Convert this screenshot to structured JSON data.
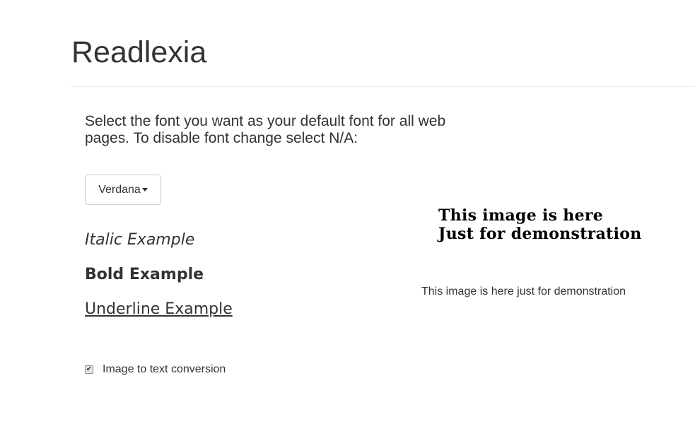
{
  "page": {
    "title": "Readlexia"
  },
  "settings": {
    "instructions": "Select the font you want as your default font for all web pages. To disable font change select N/A:",
    "font_dropdown": {
      "selected": "Verdana"
    },
    "examples": {
      "italic": "Italic Example",
      "bold": "Bold Example",
      "underline": "Underline Example"
    },
    "image_to_text": {
      "label": "Image to text conversion",
      "checked": true,
      "check_glyph": "✔"
    }
  },
  "demo": {
    "image_lines": [
      "This image is here",
      "Just for demonstration"
    ],
    "caption": "This image is here just for demonstration"
  },
  "colors": {
    "text": "#333333",
    "divider": "#eeeeee",
    "border": "#cccccc"
  }
}
